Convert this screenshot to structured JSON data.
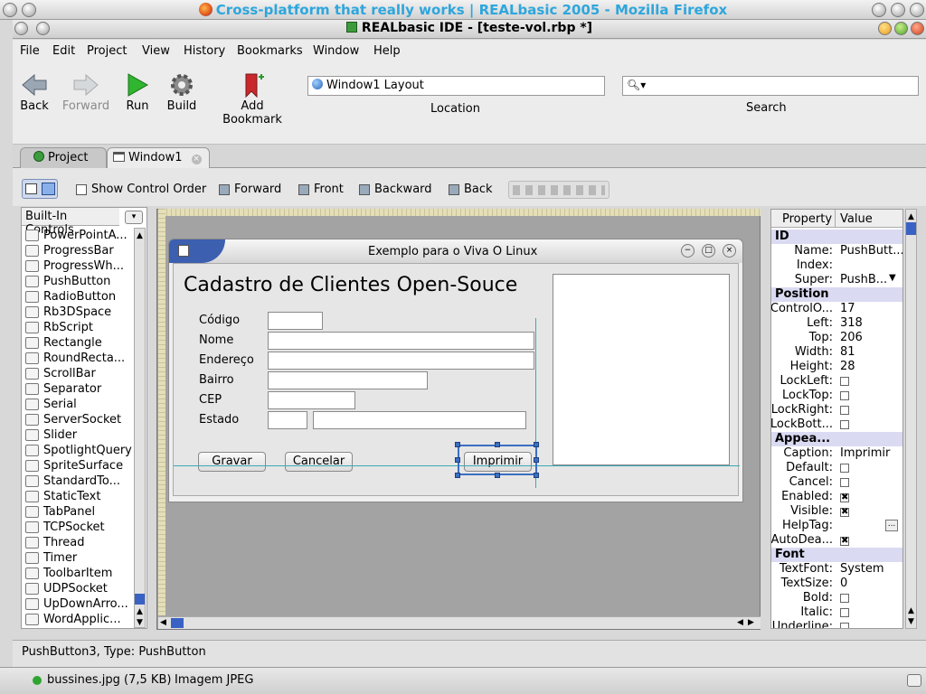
{
  "browser": {
    "title": "Cross-platform that really works | REALbasic 2005 - Mozilla Firefox",
    "status_file": "bussines.jpg (7,5 KB)",
    "status_type": "Imagem JPEG"
  },
  "ide": {
    "title": "REALbasic IDE - [teste-vol.rbp *]"
  },
  "menu": [
    "File",
    "Edit",
    "Project",
    "View",
    "History",
    "Bookmarks",
    "Window",
    "Help"
  ],
  "toolbar": {
    "back": "Back",
    "forward": "Forward",
    "run": "Run",
    "build": "Build",
    "add_bookmark": "Add Bookmark",
    "location_value": "Window1 Layout",
    "location_label": "Location",
    "search_label": "Search",
    "search_value": ""
  },
  "tabs": [
    {
      "label": "Project",
      "icon": "project-icon"
    },
    {
      "label": "Window1",
      "icon": "window-icon"
    }
  ],
  "layout_toolbar": {
    "show_order": "Show Control Order",
    "forward": "Forward",
    "front": "Front",
    "backward": "Backward",
    "back": "Back"
  },
  "controls": {
    "header": "Built-In Controls",
    "items": [
      "PowerPointA...",
      "ProgressBar",
      "ProgressWh...",
      "PushButton",
      "RadioButton",
      "Rb3DSpace",
      "RbScript",
      "Rectangle",
      "RoundRecta...",
      "ScrollBar",
      "Separator",
      "Serial",
      "ServerSocket",
      "Slider",
      "SpotlightQuery",
      "SpriteSurface",
      "StandardTo...",
      "StaticText",
      "TabPanel",
      "TCPSocket",
      "Thread",
      "Timer",
      "ToolbarItem",
      "UDPSocket",
      "UpDownArro...",
      "WordApplic..."
    ]
  },
  "sim_window": {
    "title": "Exemplo para o Viva O Linux",
    "heading": "Cadastro de Clientes Open-Souce",
    "labels": {
      "codigo": "Código",
      "nome": "Nome",
      "endereco": "Endereço",
      "bairro": "Bairro",
      "cep": "CEP",
      "estado": "Estado"
    },
    "buttons": {
      "gravar": "Gravar",
      "cancelar": "Cancelar",
      "imprimir": "Imprimir"
    }
  },
  "properties": {
    "header_property": "Property",
    "header_value": "Value",
    "sections": {
      "id": "ID",
      "position": "Position",
      "appearance": "Appea...",
      "font": "Font"
    },
    "rows": {
      "name": {
        "k": "Name:",
        "v": "PushButt..."
      },
      "index": {
        "k": "Index:",
        "v": ""
      },
      "super": {
        "k": "Super:",
        "v": "PushB..."
      },
      "control_order": {
        "k": "ControlO...",
        "v": "17"
      },
      "left": {
        "k": "Left:",
        "v": "318"
      },
      "top": {
        "k": "Top:",
        "v": "206"
      },
      "width": {
        "k": "Width:",
        "v": "81"
      },
      "height": {
        "k": "Height:",
        "v": "28"
      },
      "lockleft": {
        "k": "LockLeft:"
      },
      "locktop": {
        "k": "LockTop:"
      },
      "lockright": {
        "k": "LockRight:"
      },
      "lockbottom": {
        "k": "LockBott..."
      },
      "caption": {
        "k": "Caption:",
        "v": "Imprimir"
      },
      "default": {
        "k": "Default:"
      },
      "cancel": {
        "k": "Cancel:"
      },
      "enabled": {
        "k": "Enabled:"
      },
      "visible": {
        "k": "Visible:"
      },
      "helptag": {
        "k": "HelpTag:"
      },
      "autodeactivate": {
        "k": "AutoDea..."
      },
      "textfont": {
        "k": "TextFont:",
        "v": "System"
      },
      "textsize": {
        "k": "TextSize:",
        "v": "0"
      },
      "bold": {
        "k": "Bold:"
      },
      "italic": {
        "k": "Italic:"
      },
      "underline": {
        "k": "Underline:"
      }
    }
  },
  "status": {
    "text": "PushButton3, Type: PushButton"
  }
}
